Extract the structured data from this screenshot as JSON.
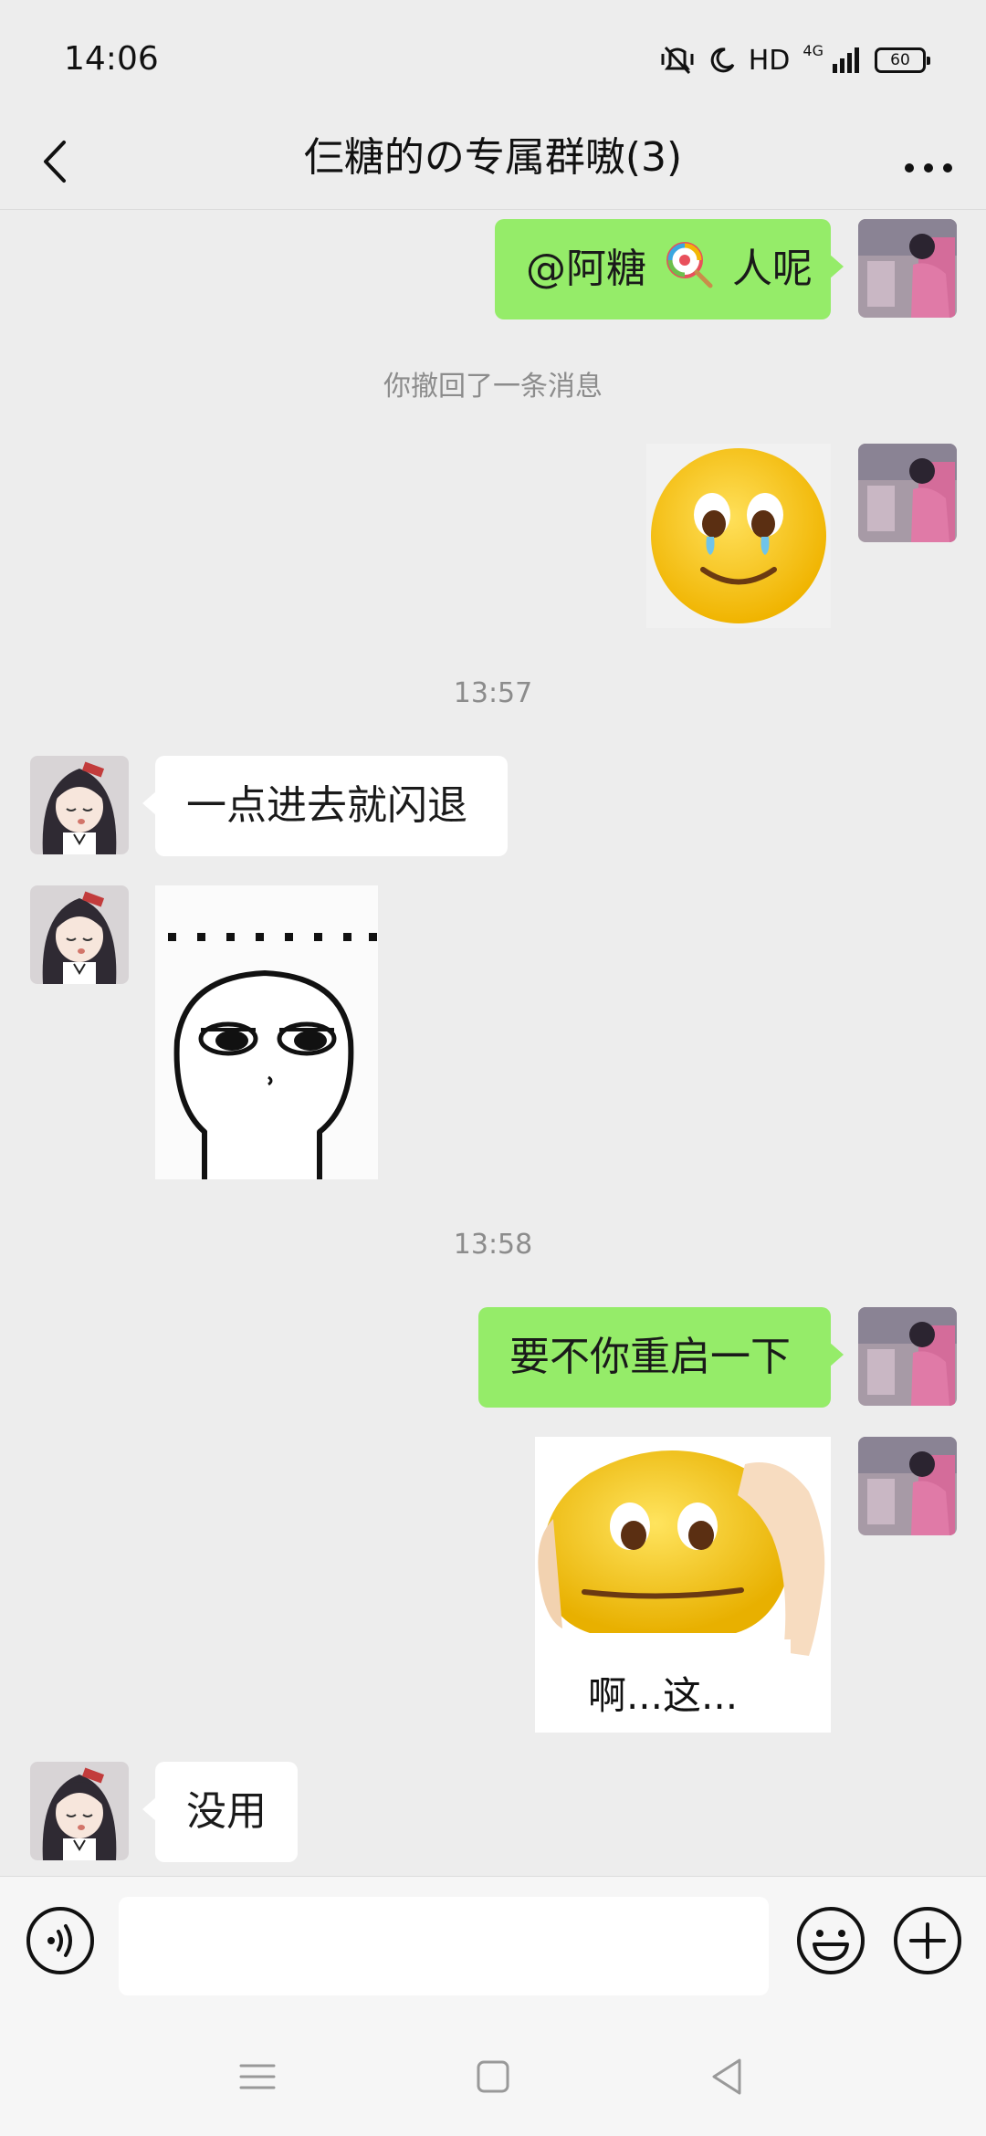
{
  "status_bar": {
    "time": "14:06",
    "hd": "HD",
    "network": "4G",
    "battery": "60",
    "icons": [
      "vibrate-mute-icon",
      "moon-icon",
      "signal-icon",
      "battery-icon"
    ]
  },
  "header": {
    "title": "仨糖的の专属群嗷(3)",
    "icons": [
      "back-arrow-icon",
      "more-options-icon"
    ]
  },
  "messages": [
    {
      "type": "text",
      "side": "mine",
      "parts": [
        "@阿糖",
        "lollipop-emoji",
        "人呢"
      ]
    },
    {
      "type": "system",
      "text": "你撤回了一条消息"
    },
    {
      "type": "sticker",
      "side": "mine",
      "sticker": "crying-smile-emoji-sticker"
    },
    {
      "type": "time",
      "text": "13:57"
    },
    {
      "type": "text",
      "side": "theirs",
      "text": "一点进去就闪退"
    },
    {
      "type": "sticker",
      "side": "theirs",
      "sticker": "doodle-face-ellipsis-sticker"
    },
    {
      "type": "time",
      "text": "13:58"
    },
    {
      "type": "text",
      "side": "mine",
      "text": "要不你重启一下"
    },
    {
      "type": "sticker",
      "side": "mine",
      "sticker": "facepalm-emoji-sticker",
      "caption": "啊...这..."
    },
    {
      "type": "text",
      "side": "theirs",
      "text": "没用"
    }
  ],
  "input_bar": {
    "value": "",
    "icons": [
      "voice-icon",
      "emoji-icon",
      "plus-icon"
    ]
  },
  "nav_bar": {
    "icons": [
      "menu-icon",
      "home-icon",
      "back-triangle-icon"
    ]
  },
  "colors": {
    "background": "#ededed",
    "my_bubble": "#95ec69",
    "their_bubble": "#ffffff",
    "system_text": "#8c8c8c"
  }
}
